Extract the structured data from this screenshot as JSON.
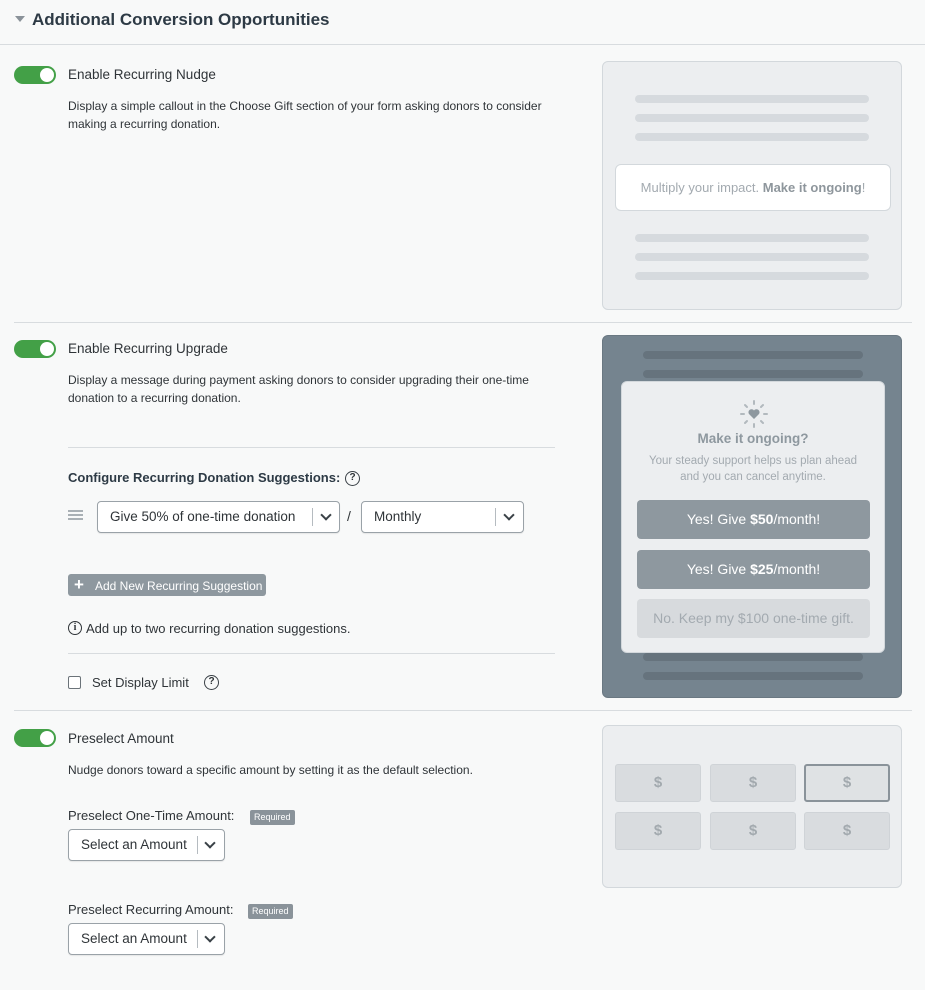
{
  "header": {
    "title": "Additional Conversion Opportunities"
  },
  "nudge": {
    "title": "Enable Recurring Nudge",
    "description": "Display a simple callout in the Choose Gift section of your form asking donors to consider making a recurring donation.",
    "enabled": true,
    "preview": {
      "callout_text": "Multiply your impact. ",
      "callout_bold": "Make it ongoing",
      "callout_end": "!"
    }
  },
  "upgrade": {
    "title": "Enable Recurring Upgrade",
    "description": "Display a message during payment asking donors to consider upgrading their one-time donation to a recurring donation.",
    "enabled": true,
    "configure_label": "Configure Recurring Donation Suggestions:",
    "suggestion_amount": "Give 50% of one-time donation",
    "slash": "/",
    "suggestion_frequency": "Monthly",
    "add_button_label": "Add New Recurring Suggestion",
    "info_text": "Add up to two recurring donation suggestions.",
    "display_limit_label": "Set Display Limit",
    "display_limit_checked": false,
    "preview": {
      "title": "Make it ongoing?",
      "text": "Your steady support helps us plan ahead and you can cancel anytime.",
      "btn1_pre": "Yes! Give ",
      "btn1_amount": "$50",
      "btn1_post": "/month!",
      "btn2_pre": "Yes! Give ",
      "btn2_amount": "$25",
      "btn2_post": "/month!",
      "btn3": "No. Keep my $100 one-time gift."
    }
  },
  "preselect": {
    "title": "Preselect Amount",
    "description": "Nudge donors toward a specific amount by setting it as the default selection.",
    "enabled": true,
    "one_time_label": "Preselect One-Time Amount:",
    "recurring_label": "Preselect Recurring Amount:",
    "required_badge": "Required",
    "select_placeholder": "Select an Amount",
    "preview": {
      "symbol": "$"
    }
  },
  "colors": {
    "toggle_on": "#43a047",
    "accent_gray": "#8e989f"
  }
}
